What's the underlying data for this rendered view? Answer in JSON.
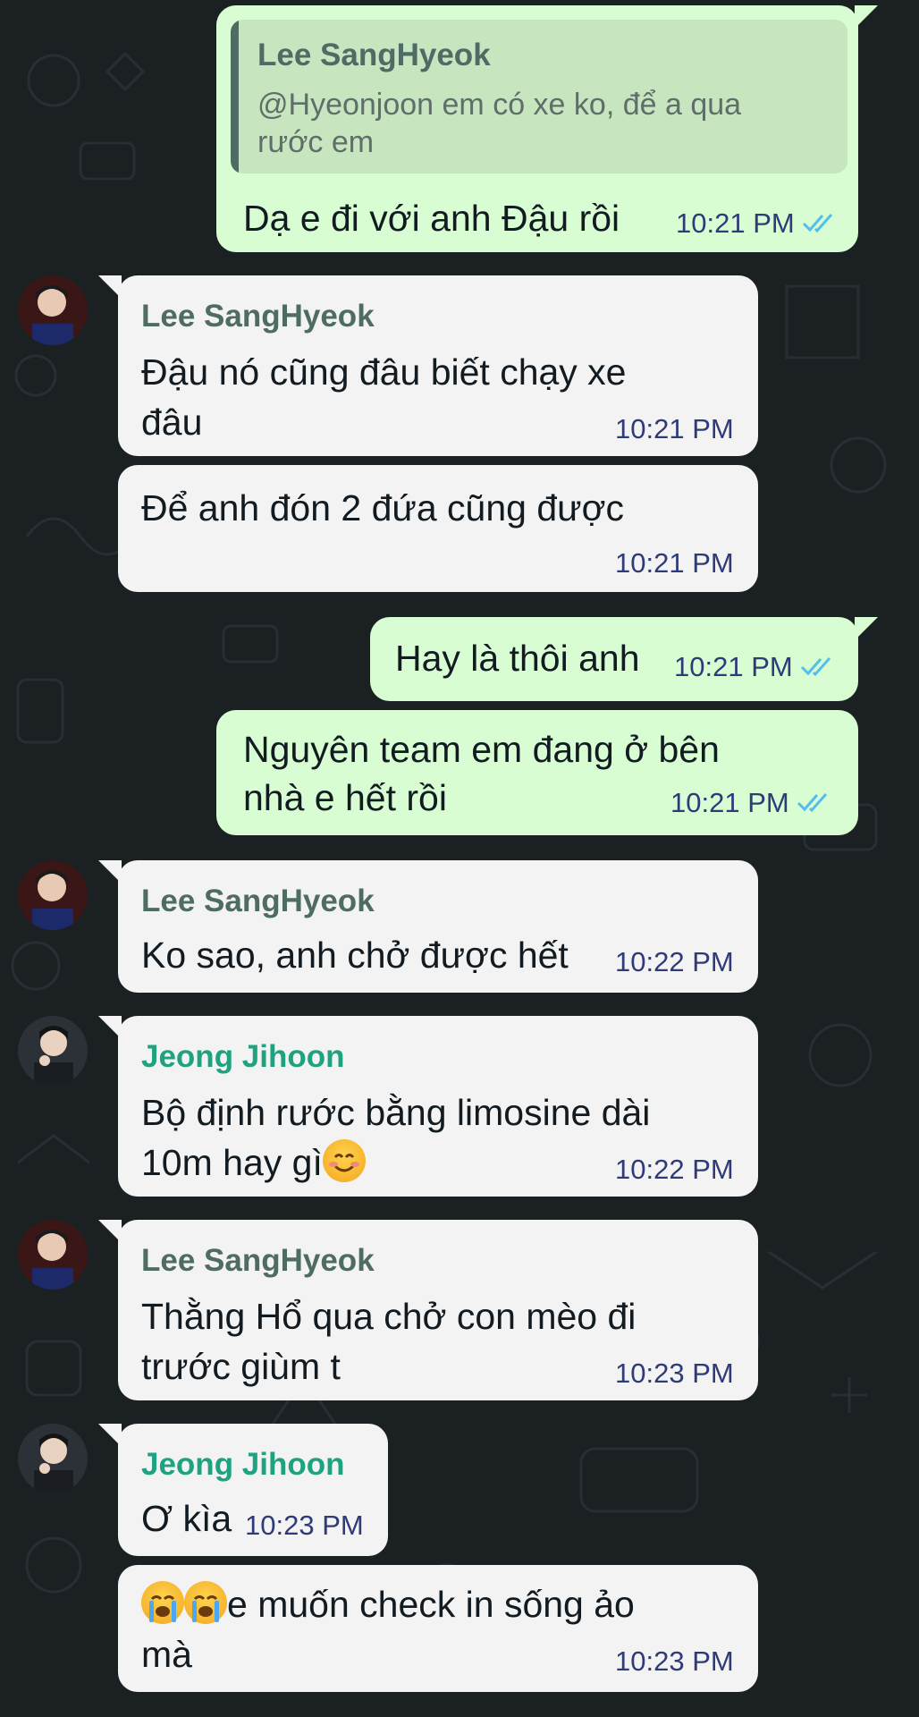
{
  "colors": {
    "background": "#1b2023",
    "incoming_bubble": "#f3f3f3",
    "outgoing_bubble": "#d9fdd3",
    "timestamp": "#2f3a78",
    "read_ticks": "#53bdeb",
    "sender_lee": "#4e6b64",
    "sender_jeong": "#1fa27f"
  },
  "messages": [
    {
      "direction": "out",
      "quote": {
        "sender": "Lee SangHyeok",
        "text": "@Hyeonjoon em có xe ko, để a qua rước em"
      },
      "lines": [
        "Dạ e đi với anh Đậu rồi"
      ],
      "time": "10:21 PM",
      "status": "read"
    },
    {
      "direction": "in",
      "sender": "Lee SangHyeok",
      "lines": [
        "Đậu nó cũng đâu biết chạy xe",
        "đâu"
      ],
      "time": "10:21 PM"
    },
    {
      "direction": "in",
      "lines": [
        "Để anh đón 2 đứa cũng được"
      ],
      "time": "10:21 PM"
    },
    {
      "direction": "out",
      "lines": [
        "Hay là thôi anh"
      ],
      "time": "10:21 PM",
      "status": "read"
    },
    {
      "direction": "out",
      "lines": [
        "Nguyên team em đang ở bên",
        "nhà e hết rồi"
      ],
      "time": "10:21 PM",
      "status": "read"
    },
    {
      "direction": "in",
      "sender": "Lee SangHyeok",
      "lines": [
        "Ko sao, anh chở được hết"
      ],
      "time": "10:22 PM"
    },
    {
      "direction": "in",
      "sender": "Jeong Jihoon",
      "lines": [
        "Bộ định rước bằng limosine dài",
        "10m hay gì"
      ],
      "emoji_after_line2": "smiling-face-emoji",
      "time": "10:22 PM"
    },
    {
      "direction": "in",
      "sender": "Lee SangHyeok",
      "lines": [
        "Thằng Hổ qua chở con mèo đi",
        "trước giùm t"
      ],
      "time": "10:23 PM"
    },
    {
      "direction": "in",
      "sender": "Jeong Jihoon",
      "lines": [
        "Ơ kìa"
      ],
      "time": "10:23 PM"
    },
    {
      "direction": "in",
      "lines": [
        "e muốn check in sống ảo",
        "mà"
      ],
      "emoji_before_line1": [
        "loudly-crying-emoji",
        "loudly-crying-emoji"
      ],
      "time": "10:23 PM"
    }
  ]
}
